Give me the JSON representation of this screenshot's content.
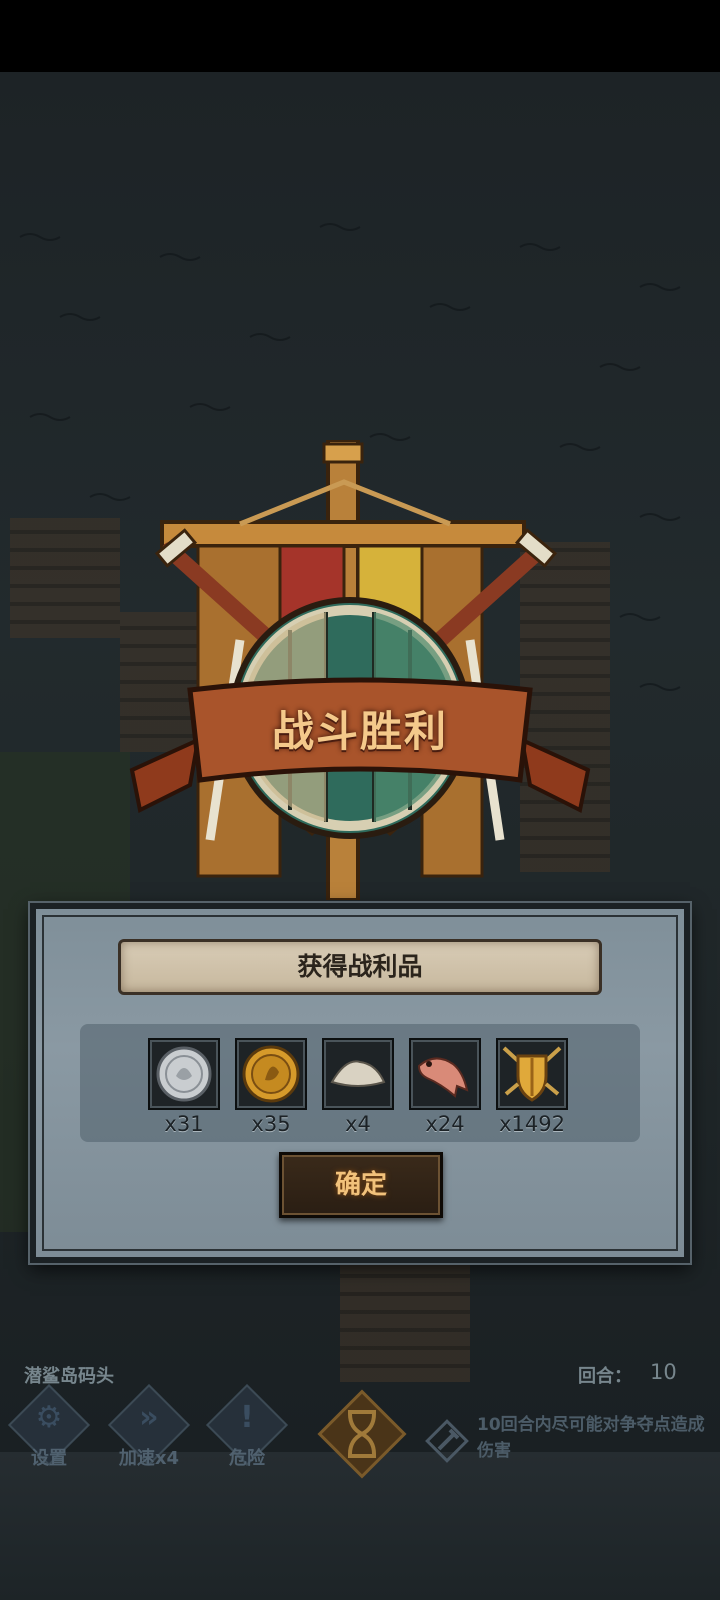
{
  "victory": {
    "title": "战斗胜利"
  },
  "loot": {
    "header": "获得战利品",
    "items": [
      {
        "icon": "silver-coin-icon",
        "count": "x31"
      },
      {
        "icon": "gold-coin-icon",
        "count": "x35"
      },
      {
        "icon": "flour-pile-icon",
        "count": "x4"
      },
      {
        "icon": "fish-icon",
        "count": "x24"
      },
      {
        "icon": "golden-shield-emblem-icon",
        "count": "x1492"
      }
    ],
    "confirm_label": "确定"
  },
  "hud": {
    "location": "潜鲨岛码头",
    "round_label": "回合：",
    "round_value": "10",
    "buttons": [
      {
        "icon": "gear-icon",
        "label": "设置"
      },
      {
        "icon": "fast-forward-icon",
        "label": "加速x4"
      },
      {
        "icon": "danger-exclamation-icon",
        "label": "危险"
      }
    ],
    "hint": "10回合内尽可能对争夺点造成伤害"
  },
  "colors": {
    "title_gold": "#f4c98b",
    "panel_steel": "#8a99a3",
    "parchment": "#d8ccb6",
    "button_text": "#f2c27b"
  }
}
